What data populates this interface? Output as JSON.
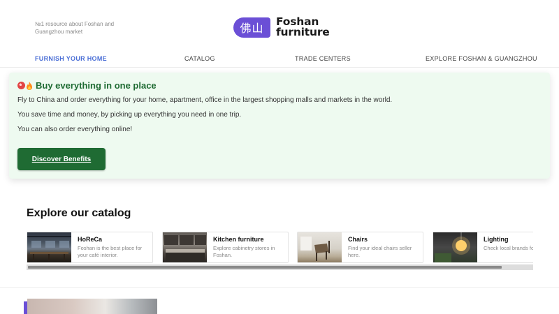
{
  "header": {
    "tagline": "№1 resource about Foshan and Guangzhou market",
    "logo_badge": "佛山",
    "logo_line1": "Foshan",
    "logo_line2": "furniture",
    "brand_color": "#6b4fd6"
  },
  "nav": {
    "items": [
      {
        "label": "FURNISH YOUR HOME",
        "active": true
      },
      {
        "label": "CATALOG",
        "active": false
      },
      {
        "label": "TRADE CENTERS",
        "active": false
      },
      {
        "label": "EXPLORE FOSHAN & GUANGZHOU",
        "active": false
      }
    ],
    "active_color": "#4b6fd6"
  },
  "promo": {
    "icons": [
      "red-badge-icon",
      "fire-icon"
    ],
    "title": "Buy everything in one place",
    "lines": [
      "Fly to China and order everything for your home, apartment, office in the largest shopping malls and markets in the world.",
      "You save time and money, by picking up everything you need in one trip.",
      "You can also order everything online!"
    ],
    "cta_label": "Discover Benefits",
    "background": "#eefaf0",
    "accent": "#1f6b33"
  },
  "catalog": {
    "title": "Explore our catalog",
    "cards": [
      {
        "title": "HoReCa",
        "desc": "Foshan is the best place for your café interior.",
        "image": "restaurant-photo"
      },
      {
        "title": "Kitchen furniture",
        "desc": "Explore cabinetry stores in Foshan.",
        "image": "kitchen-photo"
      },
      {
        "title": "Chairs",
        "desc": "Find your ideal chairs seller here.",
        "image": "chairs-photo"
      },
      {
        "title": "Lighting",
        "desc": "Check local brands for lightning.",
        "image": "lighting-photo"
      }
    ],
    "scroll_position": 0.94
  }
}
